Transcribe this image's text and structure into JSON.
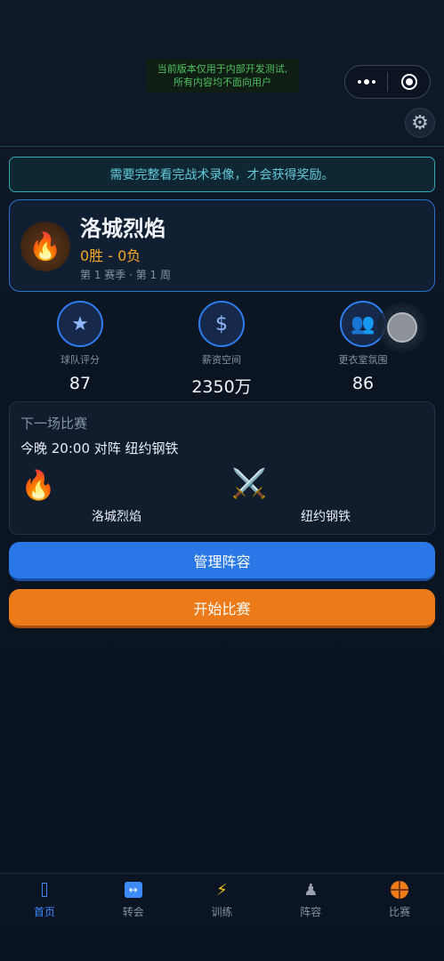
{
  "dev_notice": {
    "line1": "当前版本仅用于内部开发测试,",
    "line2": "所有内容均不面向用户"
  },
  "reward_banner": "需要完整看完战术录像，才会获得奖励。",
  "team": {
    "name": "洛城烈焰",
    "record": "0胜 - 0负",
    "season": "第 1 赛季 · 第 1 周",
    "logo": "🔥"
  },
  "stats": [
    {
      "label": "球队评分",
      "value": "87",
      "icon": "★",
      "icon_name": "star-icon"
    },
    {
      "label": "薪资空间",
      "value": "2350万",
      "icon": "$",
      "icon_name": "dollar-icon"
    },
    {
      "label": "更衣室氛围",
      "value": "86",
      "icon": "👥",
      "icon_name": "people-icon"
    }
  ],
  "next_match": {
    "title": "下一场比赛",
    "time": "今晚 20:00 对阵 纽约钢铁",
    "home": {
      "name": "洛城烈焰",
      "icon": "🔥"
    },
    "away": {
      "name": "纽约钢铁",
      "icon": "⚔️"
    }
  },
  "buttons": {
    "manage": "管理阵容",
    "start": "开始比赛"
  },
  "tabbar": [
    {
      "label": "首页",
      "icon": "home-icon",
      "active": true
    },
    {
      "label": "转会",
      "icon": "transfer-icon",
      "active": false
    },
    {
      "label": "训练",
      "icon": "lightning-icon",
      "active": false
    },
    {
      "label": "阵容",
      "icon": "pawn-icon",
      "active": false
    },
    {
      "label": "比赛",
      "icon": "basketball-icon",
      "active": false
    }
  ],
  "colors": {
    "accent_blue": "#2a77e8",
    "accent_orange": "#ed7a18",
    "record_gold": "#f5a623",
    "banner_teal": "#62c9d9"
  }
}
